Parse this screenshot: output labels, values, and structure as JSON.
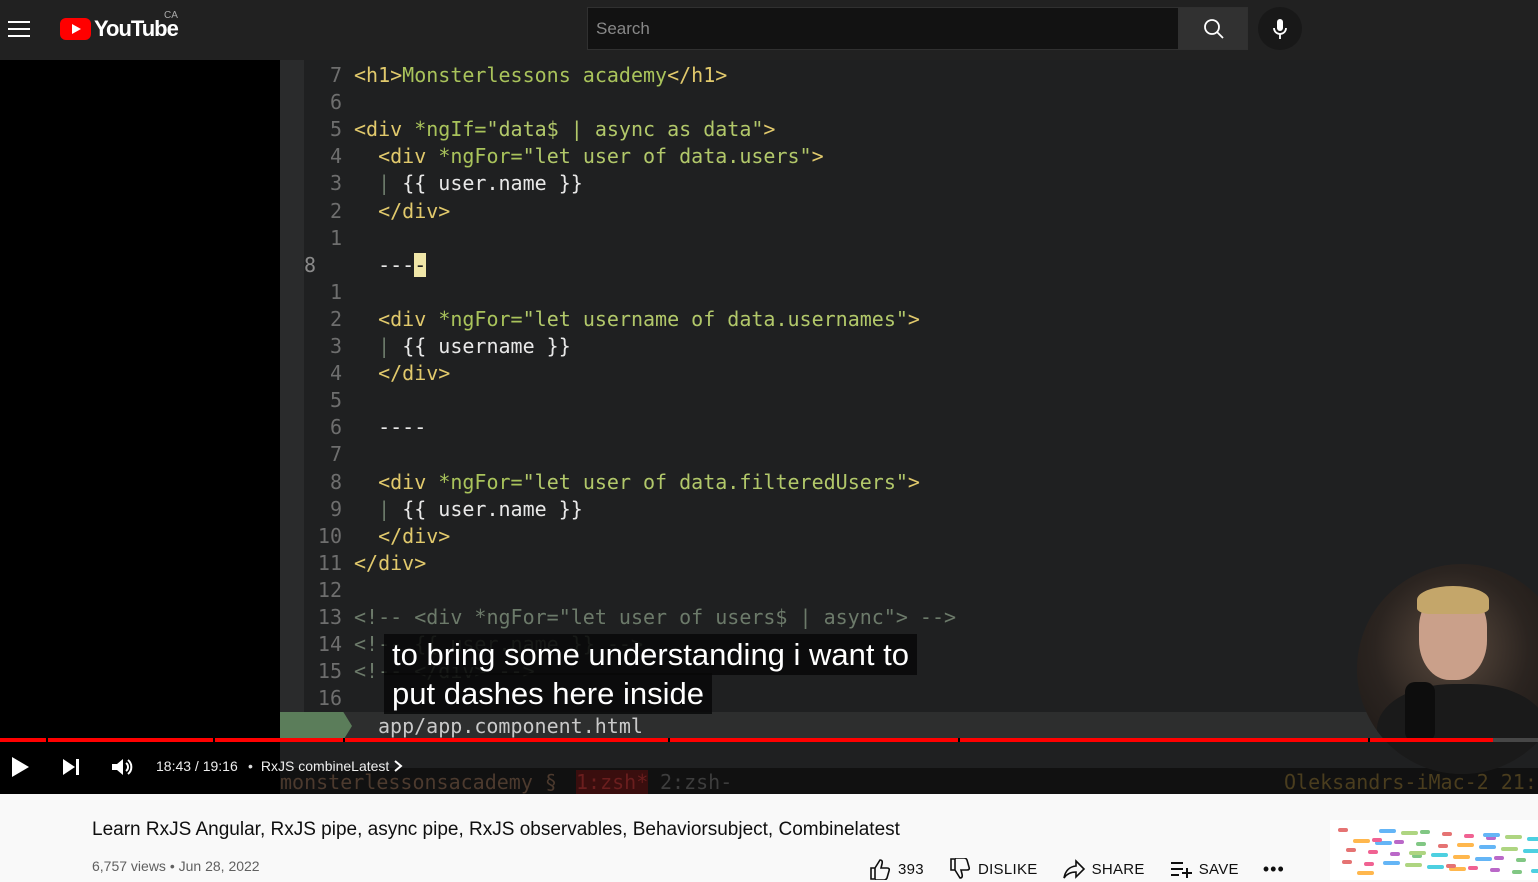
{
  "header": {
    "logo_text": "YouTube",
    "region": "CA",
    "search_placeholder": "Search"
  },
  "editor": {
    "lines": [
      {
        "n": "7",
        "html": "<span class='tag'>&lt;h1&gt;</span><span class='attr'>Monsterlessons academy</span><span class='tag'>&lt;/h1&gt;</span>"
      },
      {
        "n": "6",
        "html": ""
      },
      {
        "n": "5",
        "html": "<span class='tag'>&lt;div</span> <span class='attr'>*ngIf=</span><span class='str'>\"data$ | async as data\"</span><span class='tag'>&gt;</span>"
      },
      {
        "n": "4",
        "html": "  <span class='tag'>&lt;div</span> <span class='attr'>*ngFor=</span><span class='str'>\"let user of data.users\"</span><span class='tag'>&gt;</span>"
      },
      {
        "n": "3",
        "html": "  <span class='cmt'>|</span> <span class='tpl'>{{ user.name }}</span>"
      },
      {
        "n": "2",
        "html": "  <span class='tag'>&lt;/div&gt;</span>"
      },
      {
        "n": "1",
        "html": ""
      },
      {
        "n": "8",
        "html": "  <span class='tpl'>---</span><span class='cursor'>-</span>",
        "current": true
      },
      {
        "n": "1",
        "html": ""
      },
      {
        "n": "2",
        "html": "  <span class='tag'>&lt;div</span> <span class='attr'>*ngFor=</span><span class='str'>\"let username of data.usernames\"</span><span class='tag'>&gt;</span>"
      },
      {
        "n": "3",
        "html": "  <span class='cmt'>|</span> <span class='tpl'>{{ username }}</span>"
      },
      {
        "n": "4",
        "html": "  <span class='tag'>&lt;/div&gt;</span>"
      },
      {
        "n": "5",
        "html": ""
      },
      {
        "n": "6",
        "html": "  <span class='tpl'>----</span>"
      },
      {
        "n": "7",
        "html": ""
      },
      {
        "n": "8",
        "html": "  <span class='tag'>&lt;div</span> <span class='attr'>*ngFor=</span><span class='str'>\"let user of data.filteredUsers\"</span><span class='tag'>&gt;</span>"
      },
      {
        "n": "9",
        "html": "  <span class='cmt'>|</span> <span class='tpl'>{{ user.name }}</span>"
      },
      {
        "n": "10",
        "html": "  <span class='tag'>&lt;/div&gt;</span>"
      },
      {
        "n": "11",
        "html": "<span class='tag'>&lt;/div&gt;</span>"
      },
      {
        "n": "12",
        "html": ""
      },
      {
        "n": "13",
        "html": "<span class='cmt'>&lt;!-- &lt;div *ngFor=\"let user of users$ | async\"&gt; --&gt;</span>"
      },
      {
        "n": "14",
        "html": "<span class='cmt'>&lt;!-- {{ user.name }} --&gt;</span>"
      },
      {
        "n": "15",
        "html": "<span class='cmt'>&lt;!-- &lt;/div&gt; --&gt;</span>"
      },
      {
        "n": "16",
        "html": ""
      }
    ],
    "status_file": "app/app.component.html"
  },
  "tmux": {
    "session": "monsterlessonsacademy §",
    "window1": "1:zsh*",
    "window2": "2:zsh-",
    "host": "Oleksandrs-iMac-2 21:"
  },
  "captions": {
    "line1": "to bring some understanding i want to",
    "line2": "put dashes here inside"
  },
  "player": {
    "time": "18:43 / 19:16",
    "chapter": "RxJS combineLatest",
    "progress_fraction": 0.971
  },
  "video": {
    "title": "Learn RxJS Angular, RxJS pipe, async pipe, RxJS observables, Behaviorsubject, Combinelatest",
    "views": "6,757 views",
    "date": "Jun 28, 2022",
    "likes": "393",
    "dislike_label": "DISLIKE",
    "share_label": "SHARE",
    "save_label": "SAVE"
  },
  "colors": {
    "progress": "#ff0000",
    "brand": "#ff0000"
  }
}
